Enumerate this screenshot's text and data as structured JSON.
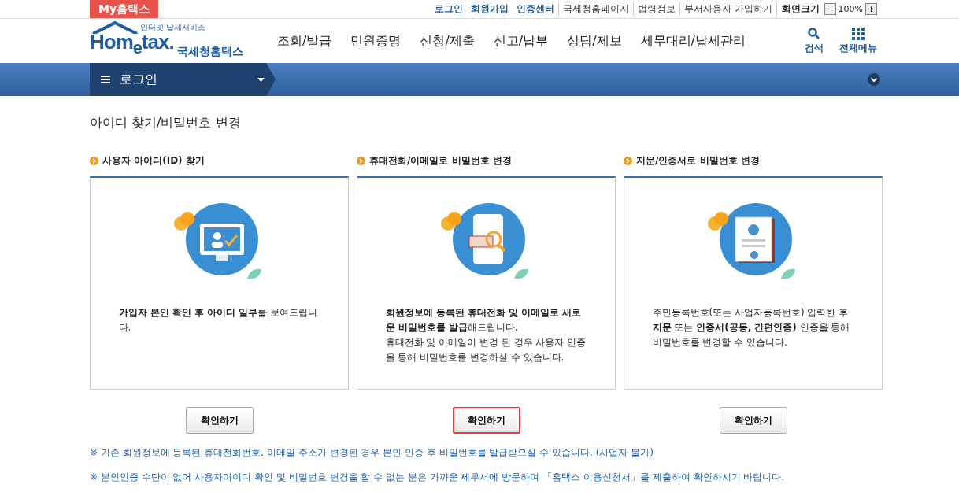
{
  "top_bar": {
    "my_tab": "My홈택스",
    "links": [
      {
        "label": "로그인",
        "kind": "primary"
      },
      {
        "label": "회원가입",
        "kind": "primary"
      },
      {
        "label": "인증센터",
        "kind": "primary"
      },
      {
        "label": "국세청홈페이지",
        "kind": "plain"
      },
      {
        "label": "법령정보",
        "kind": "plain"
      },
      {
        "label": "부서사용자 가입하기",
        "kind": "plain"
      }
    ],
    "zoom_label": "화면크기",
    "zoom_out": "−",
    "zoom_value": "100%",
    "zoom_in": "+"
  },
  "logo": {
    "tagline": "인터넷 납세서비스",
    "name": "Hom$_{e}$tax.",
    "subtitle": "국세청홈택스"
  },
  "nav": [
    "조회/발급",
    "민원증명",
    "신청/제출",
    "신고/납부",
    "상담/제보",
    "세무대리/납세관리"
  ],
  "nav_tools": [
    {
      "label": "검색",
      "kind": "search"
    },
    {
      "label": "전체메뉴",
      "kind": "grid"
    }
  ],
  "breadcrumb": {
    "label": "로그인"
  },
  "page_title": "아이디 찾기/비밀번호 변경",
  "sections": [
    {
      "heading": "사용자 아이디(ID) 찾기",
      "kind": "monitor",
      "paragraphs": [
        "**가입자 본인 확인 후 아이디 일부**를 보여드립니다."
      ],
      "button": {
        "label": "확인하기",
        "selected": false
      }
    },
    {
      "heading": "휴대전화/이메일로 비밀번호 변경",
      "kind": "phone",
      "paragraphs": [
        "**회원정보에 등록된 휴대전화 및 이메일로 새로운 비밀번호를 발급**해드립니다.",
        "휴대전화 및 이메일이 변경 된 경우 사용자 인증을 통해 비밀번호를 변경하실 수 있습니다."
      ],
      "button": {
        "label": "확인하기",
        "selected": true
      }
    },
    {
      "heading": "지문/인증서로 비밀번호 변경",
      "kind": "certificate",
      "paragraphs": [
        "주민등록번호(또는 사업자등록번호) 입력한 후 **지문** 또는 **인증서(공동, 간편인증)** 인증을 통해 비밀번호를 변경할 수 있습니다."
      ],
      "button": {
        "label": "확인하기",
        "selected": false
      }
    }
  ],
  "notes": [
    "※ 기존 회원정보에 등록된 휴대전화번호, 이메일 주소가 변경된 경우 본인 인증 후 비밀번호를 발급받으실 수 있습니다. (사업자 불가)",
    "※ 본인인증 수단이 없어 사용자아이디 확인 및 비밀번호 변경을 할 수 없는 분은 가까운 세무서에 방문하여 「홈택스 이용신청서」를 제출하여 확인하시기 바랍니다."
  ]
}
